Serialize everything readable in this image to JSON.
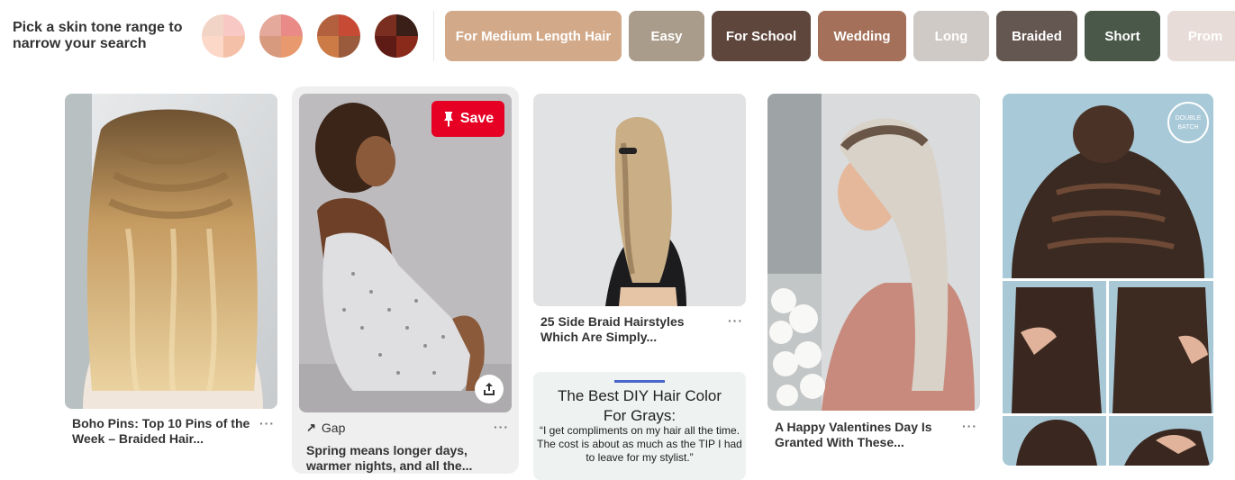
{
  "skin_tone": {
    "prompt": "Pick a skin tone range to narrow your search",
    "swatches": [
      {
        "name": "light",
        "colors": [
          "#f2d4c6",
          "#f8c8c4",
          "#fbd8c8",
          "#f4c0a8"
        ]
      },
      {
        "name": "medium-light",
        "colors": [
          "#e4a99a",
          "#e98a86",
          "#d79a7e",
          "#e89a6e"
        ]
      },
      {
        "name": "medium-dark",
        "colors": [
          "#b3603e",
          "#c64a34",
          "#cc7a46",
          "#9a5a3c"
        ]
      },
      {
        "name": "dark",
        "colors": [
          "#7a2e1f",
          "#3a1e18",
          "#5e1a14",
          "#8a2a1a"
        ]
      }
    ]
  },
  "filters": [
    {
      "label": "For Medium Length Hair",
      "color": "#d2aa8a"
    },
    {
      "label": "Easy",
      "color": "#a99c8a"
    },
    {
      "label": "For School",
      "color": "#5e463c"
    },
    {
      "label": "Wedding",
      "color": "#a4705a"
    },
    {
      "label": "Long",
      "color": "#cfcac6"
    },
    {
      "label": "Braided",
      "color": "#645650"
    },
    {
      "label": "Short",
      "color": "#495848"
    },
    {
      "label": "Prom",
      "color": "#e7dcd8"
    }
  ],
  "pins": {
    "pin1": {
      "title": "Boho Pins: Top 10 Pins of the Week – Braided Hair...",
      "more": "···",
      "image_icon": "braided-blonde-hair-image"
    },
    "pin2": {
      "save_label": "Save",
      "source": "Gap",
      "title": "Spring means longer days, warmer nights, and all the...",
      "more": "···",
      "image_icon": "woman-sundress-image"
    },
    "pin3": {
      "title": "25 Side Braid Hairstyles Which Are Simply...",
      "more": "···",
      "image_icon": "side-braid-image"
    },
    "pin4": {
      "title": "The Best DIY Hair Color For Grays:",
      "quote": "“I get compliments on my hair all the time. The cost is about as much as the TIP I had to leave for my stylist.”",
      "accent": "#4a65c9"
    },
    "pin5": {
      "title": "A Happy Valentines Day Is Granted With These...",
      "more": "···",
      "image_icon": "woman-pink-dress-image"
    },
    "pin6": {
      "watermark": "DOUBLE BATCH",
      "image_icon": "french-braid-tutorial-image"
    }
  }
}
